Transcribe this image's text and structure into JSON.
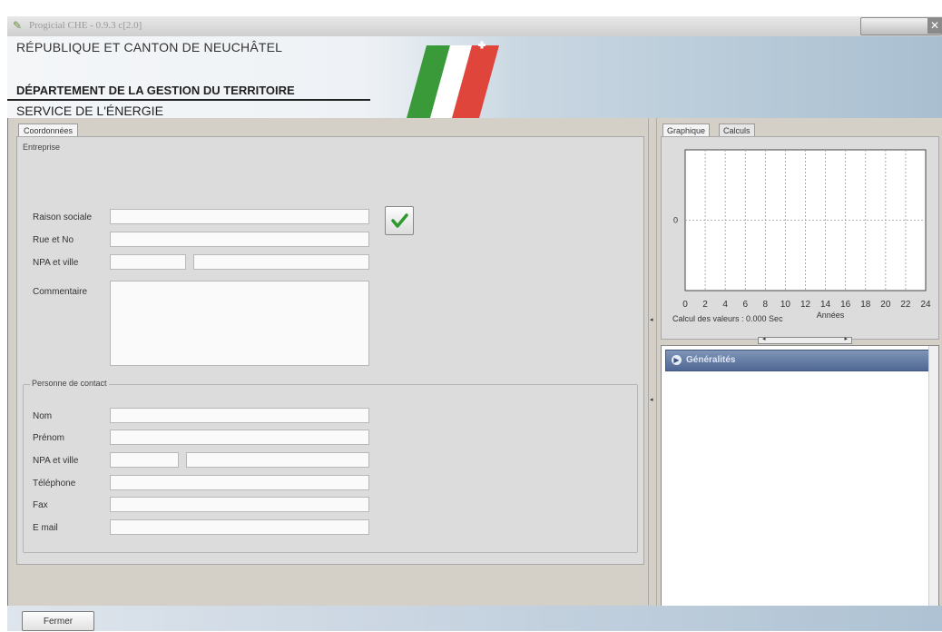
{
  "window": {
    "title": "Progicial CHE - 0.9.3 c[2.0]"
  },
  "banner": {
    "line1": "RÉPUBLIQUE ET CANTON DE NEUCHÂTEL",
    "line2": "DÉPARTEMENT DE LA GESTION DU TERRITOIRE",
    "line3": "SERVICE DE L'ÉNERGIE",
    "colors": {
      "green": "#3a9a3a",
      "white": "#ffffff",
      "red": "#e0453c"
    }
  },
  "left": {
    "tab": "Coordonnées",
    "entreprise": {
      "legend": "Entreprise",
      "labels": {
        "raison": "Raison sociale",
        "rue": "Rue et No",
        "npa": "NPA et ville",
        "commentaire": "Commentaire"
      }
    },
    "contact": {
      "legend": "Personne de contact",
      "labels": {
        "nom": "Nom",
        "prenom": "Prénom",
        "npa": "NPA et ville",
        "telephone": "Téléphone",
        "fax": "Fax",
        "email": "E mail"
      }
    }
  },
  "right": {
    "tabs": [
      "Graphique",
      "Calculs"
    ],
    "chart_data": {
      "type": "line",
      "xlabel": "Années",
      "ylabel": "",
      "x_ticks": [
        "0",
        "2",
        "4",
        "6",
        "8",
        "10",
        "12",
        "14",
        "16",
        "18",
        "20",
        "22",
        "24"
      ],
      "y_ticks": [
        "0"
      ],
      "xlim": [
        0,
        24
      ],
      "grid": true,
      "series": []
    },
    "calc_text": "Calcul des valeurs : 0.000 Sec",
    "list_header": "Généralités"
  },
  "footer": {
    "close_label": "Fermer"
  }
}
